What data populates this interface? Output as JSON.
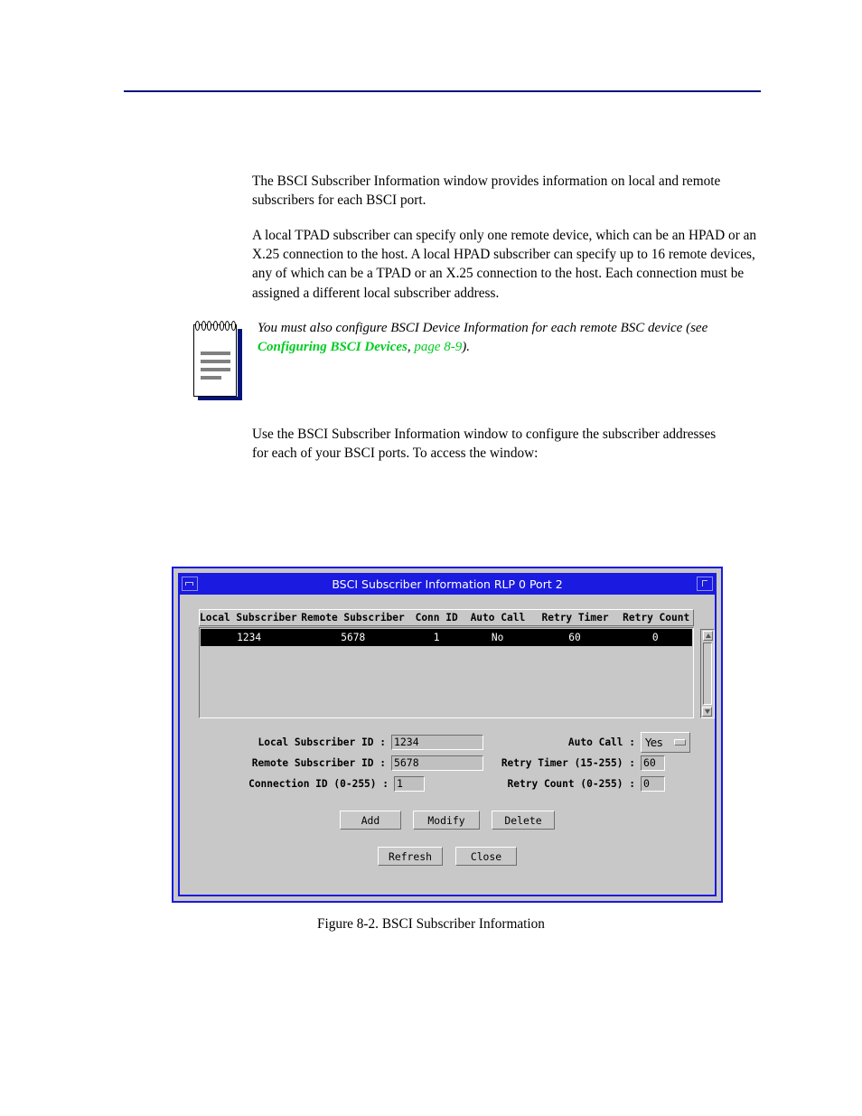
{
  "document": {
    "paragraphs": [
      "The BSCI Subscriber Information window provides information on local and remote subscribers for each BSCI port.",
      "A local TPAD subscriber can specify only one remote device, which can be an HPAD or an X.25 connection to the host. A local HPAD subscriber can specify up to 16 remote devices, any of which can be a TPAD or an X.25 connection to the host. Each connection must be assigned a different local subscriber address."
    ],
    "note": {
      "text_before": "You must also configure BSCI Device Information for each remote BSC device (see ",
      "link_text": "Configuring BSCI Devices",
      "link_separator": ", ",
      "page_ref": "page 8-9",
      "text_after": ").",
      "link_color": "#00cc22",
      "icon": "notepad-icon"
    },
    "paragraph_after": "Use the BSCI Subscriber Information window to configure the subscriber addresses for each of your BSCI ports. To access the window:",
    "figure_caption": "Figure 8-2.  BSCI Subscriber Information",
    "rule_color": "#00157a"
  },
  "dialog": {
    "title": "BSCI Subscriber Information RLP 0 Port 2",
    "frame_color": "#1a1ae0",
    "face_color": "#c8c8c8",
    "minimize_icon": "minimize-icon",
    "maximize_icon": "maximize-icon",
    "table": {
      "columns": [
        "Local Subscriber",
        "Remote Subscriber",
        "Conn ID",
        "Auto Call",
        "Retry Timer",
        "Retry Count"
      ],
      "rows": [
        {
          "local_subscriber": "1234",
          "remote_subscriber": "5678",
          "conn_id": "1",
          "auto_call": "No",
          "retry_timer": "60",
          "retry_count": "0",
          "selected": true
        }
      ]
    },
    "scrollbar": {
      "up_icon": "scroll-up-arrow-icon",
      "down_icon": "scroll-down-arrow-icon"
    },
    "form": {
      "local_subscriber_label": "Local Subscriber ID :",
      "local_subscriber_value": "1234",
      "remote_subscriber_label": "Remote Subscriber ID :",
      "remote_subscriber_value": "5678",
      "connection_id_label": "Connection ID (0-255) :",
      "connection_id_value": "1",
      "auto_call_label": "Auto Call :",
      "auto_call_value": "Yes",
      "retry_timer_label": "Retry Timer (15-255) :",
      "retry_timer_value": "60",
      "retry_count_label": "Retry Count (0-255) :",
      "retry_count_value": "0"
    },
    "buttons": {
      "add": "Add",
      "modify": "Modify",
      "delete": "Delete",
      "refresh": "Refresh",
      "close": "Close"
    }
  }
}
